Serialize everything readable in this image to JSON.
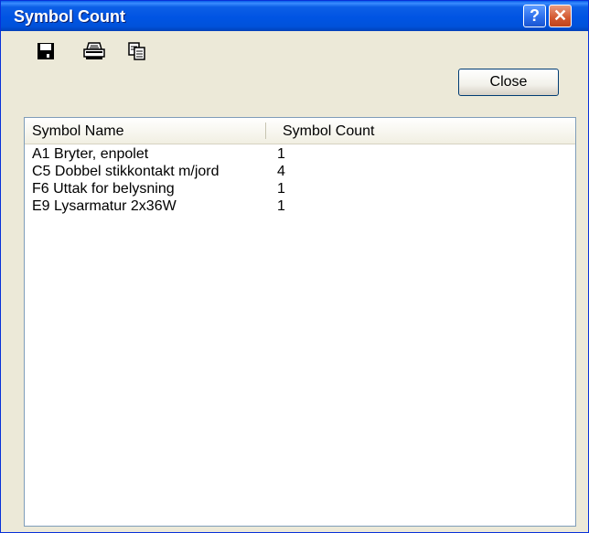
{
  "window": {
    "title": "Symbol Count",
    "help_label": "?",
    "close_glyph": "✕"
  },
  "toolbar": {
    "icons": [
      "save-icon",
      "print-icon",
      "copy-icon"
    ],
    "close_label": "Close"
  },
  "table": {
    "columns": [
      "Symbol Name",
      "Symbol Count"
    ],
    "rows": [
      {
        "name": "A1 Bryter, enpolet",
        "count": "1"
      },
      {
        "name": "C5 Dobbel stikkontakt m/jord",
        "count": "4"
      },
      {
        "name": "F6 Uttak for belysning",
        "count": "1"
      },
      {
        "name": "E9 Lysarmatur 2x36W",
        "count": "1"
      }
    ]
  },
  "colors": {
    "titlebar": "#0054E3",
    "window_bg": "#ECE9D8",
    "close_btn": "#D3582F"
  }
}
